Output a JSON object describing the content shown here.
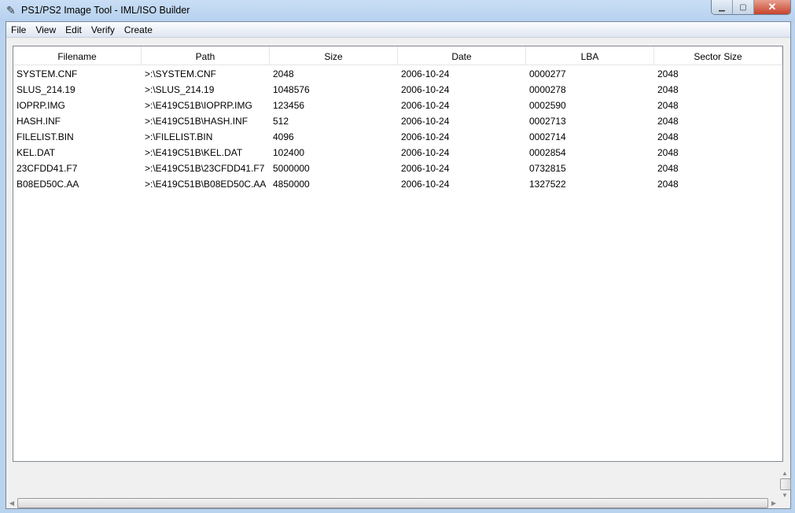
{
  "window": {
    "title": "PS1/PS2 Image Tool - IML/ISO Builder",
    "minimize": "▁",
    "maximize": "▢",
    "close": "✕",
    "icon": "feather-icon"
  },
  "menu": [
    "File",
    "View",
    "Edit",
    "Verify",
    "Create"
  ],
  "table": {
    "columns": [
      "Filename",
      "Path",
      "Size",
      "Date",
      "LBA",
      "Sector Size"
    ],
    "rows": [
      [
        "SYSTEM.CNF",
        ">:\\SYSTEM.CNF",
        "2048",
        "2006-10-24",
        "0000277",
        "2048"
      ],
      [
        "SLUS_214.19",
        ">:\\SLUS_214.19",
        "1048576",
        "2006-10-24",
        "0000278",
        "2048"
      ],
      [
        "IOPRP.IMG",
        ">:\\E419C51B\\IOPRP.IMG",
        "123456",
        "2006-10-24",
        "0002590",
        "2048"
      ],
      [
        "HASH.INF",
        ">:\\E419C51B\\HASH.INF",
        "512",
        "2006-10-24",
        "0002713",
        "2048"
      ],
      [
        "FILELIST.BIN",
        ">:\\FILELIST.BIN",
        "4096",
        "2006-10-24",
        "0002714",
        "2048"
      ],
      [
        "KEL.DAT",
        ">:\\E419C51B\\KEL.DAT",
        "102400",
        "2006-10-24",
        "0002854",
        "2048"
      ],
      [
        "23CFDD41.F7",
        ">:\\E419C51B\\23CFDD41.F7",
        "5000000",
        "2006-10-24",
        "0732815",
        "2048"
      ],
      [
        "B08ED50C.AA",
        ">:\\E419C51B\\B08ED50C.AA",
        "4850000",
        "2006-10-24",
        "1327522",
        "2048"
      ]
    ]
  }
}
